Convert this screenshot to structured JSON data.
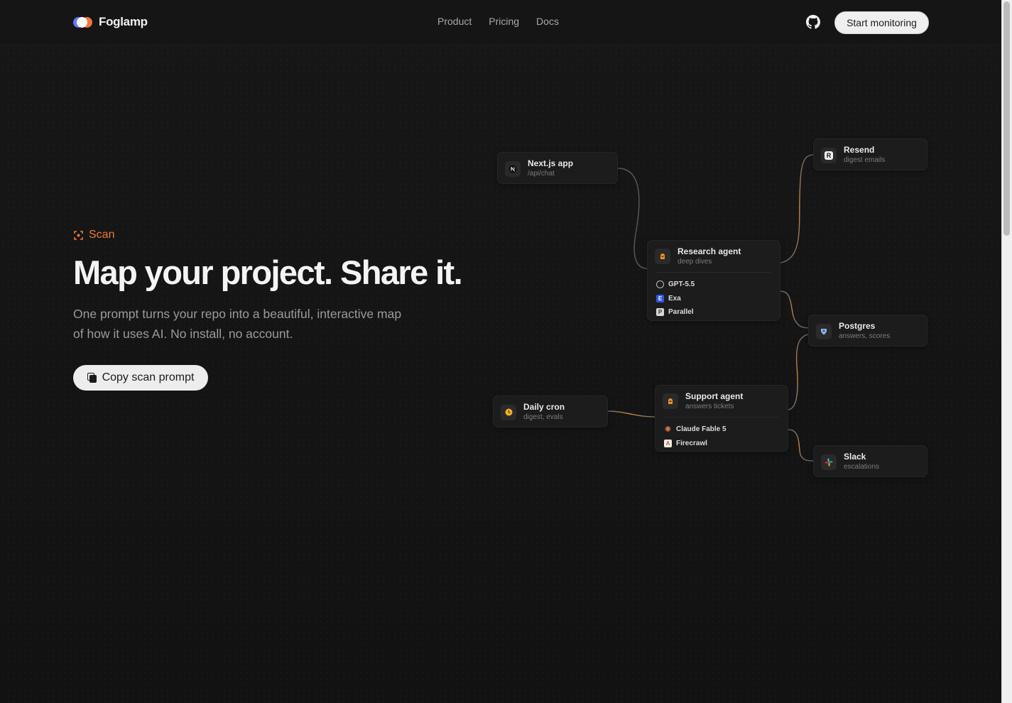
{
  "brand": {
    "name": "Foglamp"
  },
  "nav": {
    "items": [
      "Product",
      "Pricing",
      "Docs"
    ]
  },
  "header": {
    "cta_label": "Start monitoring",
    "github_icon": "github-icon"
  },
  "hero": {
    "eyebrow": "Scan",
    "eyebrow_icon": "scan-icon",
    "title": "Map your project. Share it.",
    "subtitle_line1": "One prompt turns your repo into a beautiful, interactive map",
    "subtitle_line2": "of how it uses AI. No install, no account.",
    "copy_button_label": "Copy scan prompt"
  },
  "colors": {
    "accent": "#f07a2c",
    "background": "#151515",
    "node": "#1c1c1c"
  },
  "diagram": {
    "nodes": {
      "nextjs": {
        "title": "Next.js app",
        "subtitle": "/api/chat",
        "icon": "nextjs-icon"
      },
      "resend": {
        "title": "Resend",
        "subtitle": "digest emails",
        "icon": "resend-icon"
      },
      "research": {
        "title": "Research agent",
        "subtitle": "deep dives",
        "icon": "agent-icon",
        "tools": [
          {
            "label": "GPT-5.5",
            "icon": "openai-icon"
          },
          {
            "label": "Exa",
            "icon": "exa-icon"
          },
          {
            "label": "Parallel",
            "icon": "parallel-icon"
          }
        ]
      },
      "postgres": {
        "title": "Postgres",
        "subtitle": "answers, scores",
        "icon": "postgres-icon"
      },
      "cron": {
        "title": "Daily cron",
        "subtitle": "digest, evals",
        "icon": "clock-icon"
      },
      "support": {
        "title": "Support agent",
        "subtitle": "answers tickets",
        "icon": "agent-icon",
        "tools": [
          {
            "label": "Claude Fable 5",
            "icon": "anthropic-icon"
          },
          {
            "label": "Firecrawl",
            "icon": "firecrawl-icon"
          }
        ]
      },
      "slack": {
        "title": "Slack",
        "subtitle": "escalations",
        "icon": "slack-icon"
      }
    }
  }
}
